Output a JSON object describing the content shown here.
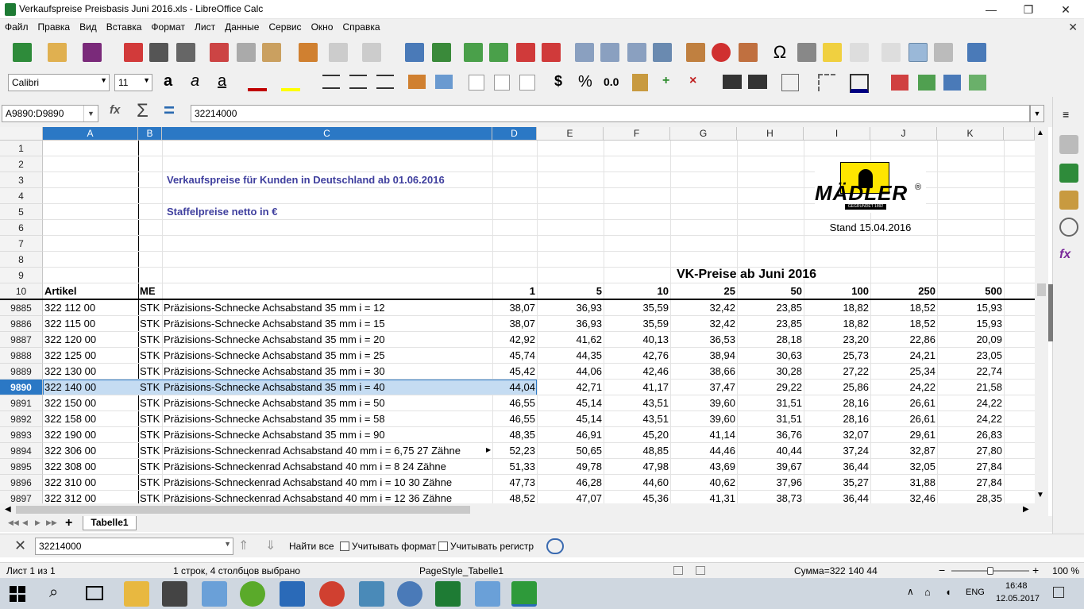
{
  "window": {
    "title": "Verkaufspreise Preisbasis Juni 2016.xls - LibreOffice Calc",
    "minimize": "—",
    "restore": "❐",
    "close": "✕"
  },
  "menu": [
    "Файл",
    "Правка",
    "Вид",
    "Вставка",
    "Формат",
    "Лист",
    "Данные",
    "Сервис",
    "Окно",
    "Справка"
  ],
  "format": {
    "font_name": "Calibri",
    "font_size": "11",
    "currency": "$",
    "percent": "%",
    "decimal": "0.0"
  },
  "formula": {
    "name_box": "A9890:D9890",
    "content": "32214000"
  },
  "columns": [
    "A",
    "B",
    "C",
    "D",
    "E",
    "F",
    "G",
    "H",
    "I",
    "J",
    "K"
  ],
  "header": {
    "title_line": "Verkaufspreise für Kunden in Deutschland ab 01.06.2016",
    "subtitle_line": "Staffelpreise netto in €",
    "logo_text": "MÄDLER",
    "logo_sub": "GEGRÜNDET 1892",
    "stand": "Stand 15.04.2016",
    "vk_title": "VK-Preise ab Juni 2016"
  },
  "head_row": {
    "number": "10",
    "artikel": "Artikel",
    "me": "ME",
    "qty": [
      "1",
      "5",
      "10",
      "25",
      "50",
      "100",
      "250",
      "500"
    ]
  },
  "top_rows": [
    "1",
    "2",
    "3",
    "4",
    "5",
    "6",
    "7",
    "8",
    "9"
  ],
  "rows": [
    {
      "n": "9885",
      "a": "322 112 00",
      "b": "STK",
      "c": "Präzisions-Schnecke   Achsabstand 35 mm   i = 12",
      "p": [
        "38,07",
        "36,93",
        "35,59",
        "32,42",
        "23,85",
        "18,82",
        "18,52",
        "15,93"
      ]
    },
    {
      "n": "9886",
      "a": "322 115 00",
      "b": "STK",
      "c": "Präzisions-Schnecke   Achsabstand 35 mm   i = 15",
      "p": [
        "38,07",
        "36,93",
        "35,59",
        "32,42",
        "23,85",
        "18,82",
        "18,52",
        "15,93"
      ]
    },
    {
      "n": "9887",
      "a": "322 120 00",
      "b": "STK",
      "c": "Präzisions-Schnecke   Achsabstand 35 mm   i = 20",
      "p": [
        "42,92",
        "41,62",
        "40,13",
        "36,53",
        "28,18",
        "23,20",
        "22,86",
        "20,09"
      ]
    },
    {
      "n": "9888",
      "a": "322 125 00",
      "b": "STK",
      "c": "Präzisions-Schnecke   Achsabstand 35 mm   i = 25",
      "p": [
        "45,74",
        "44,35",
        "42,76",
        "38,94",
        "30,63",
        "25,73",
        "24,21",
        "23,05"
      ]
    },
    {
      "n": "9889",
      "a": "322 130 00",
      "b": "STK",
      "c": "Präzisions-Schnecke   Achsabstand 35 mm   i = 30",
      "p": [
        "45,42",
        "44,06",
        "42,46",
        "38,66",
        "30,28",
        "27,22",
        "25,34",
        "22,74"
      ]
    },
    {
      "n": "9890",
      "a": "322 140 00",
      "b": "STK",
      "c": "Präzisions-Schnecke   Achsabstand 35 mm   i = 40",
      "p": [
        "44,04",
        "42,71",
        "41,17",
        "37,47",
        "29,22",
        "25,86",
        "24,22",
        "21,58"
      ]
    },
    {
      "n": "9891",
      "a": "322 150 00",
      "b": "STK",
      "c": "Präzisions-Schnecke   Achsabstand 35 mm   i = 50",
      "p": [
        "46,55",
        "45,14",
        "43,51",
        "39,60",
        "31,51",
        "28,16",
        "26,61",
        "24,22"
      ]
    },
    {
      "n": "9892",
      "a": "322 158 00",
      "b": "STK",
      "c": "Präzisions-Schnecke   Achsabstand 35 mm   i = 58",
      "p": [
        "46,55",
        "45,14",
        "43,51",
        "39,60",
        "31,51",
        "28,16",
        "26,61",
        "24,22"
      ]
    },
    {
      "n": "9893",
      "a": "322 190 00",
      "b": "STK",
      "c": "Präzisions-Schnecke   Achsabstand 35 mm   i = 90",
      "p": [
        "48,35",
        "46,91",
        "45,20",
        "41,14",
        "36,76",
        "32,07",
        "29,61",
        "26,83"
      ]
    },
    {
      "n": "9894",
      "a": "322 306 00",
      "b": "STK",
      "c": "Präzisions-Schneckenrad   Achsabstand 40 mm   i = 6,75    27 Zähne",
      "p": [
        "52,23",
        "50,65",
        "48,85",
        "44,46",
        "40,44",
        "37,24",
        "32,87",
        "27,80"
      ]
    },
    {
      "n": "9895",
      "a": "322 308 00",
      "b": "STK",
      "c": "Präzisions-Schneckenrad   Achsabstand 40 mm   i = 8    24 Zähne",
      "p": [
        "51,33",
        "49,78",
        "47,98",
        "43,69",
        "39,67",
        "36,44",
        "32,05",
        "27,84"
      ]
    },
    {
      "n": "9896",
      "a": "322 310 00",
      "b": "STK",
      "c": "Präzisions-Schneckenrad   Achsabstand 40 mm   i = 10    30 Zähne",
      "p": [
        "47,73",
        "46,28",
        "44,60",
        "40,62",
        "37,96",
        "35,27",
        "31,88",
        "27,84"
      ]
    },
    {
      "n": "9897",
      "a": "322 312 00",
      "b": "STK",
      "c": "Präzisions-Schneckenrad   Achsabstand 40 mm   i = 12   36 Zähne",
      "p": [
        "48,52",
        "47,07",
        "45,36",
        "41,31",
        "38,73",
        "36,44",
        "32,46",
        "28,35"
      ]
    }
  ],
  "selected_row": "9890",
  "tabs": {
    "sheet_name": "Tabelle1",
    "add": "+"
  },
  "findbar": {
    "value": "32214000",
    "find_all": "Найти все",
    "match_format": "Учитывать формат",
    "match_case": "Учитывать регистр"
  },
  "status": {
    "sheet": "Лист 1 из 1",
    "selection": "1 строк, 4 столбцов выбрано",
    "page_style": "PageStyle_Tabelle1",
    "sum": "Сумма=322 140 44",
    "zoom": "100 %",
    "zoom_level": 0.5
  },
  "taskbar": {
    "lang": "ENG",
    "time": "16:48",
    "date": "12.05.2017"
  },
  "colors": {
    "selection": "#2b78c5",
    "header_text": "#3f3f9e",
    "toolbar_bg": "#f0f0f0"
  }
}
